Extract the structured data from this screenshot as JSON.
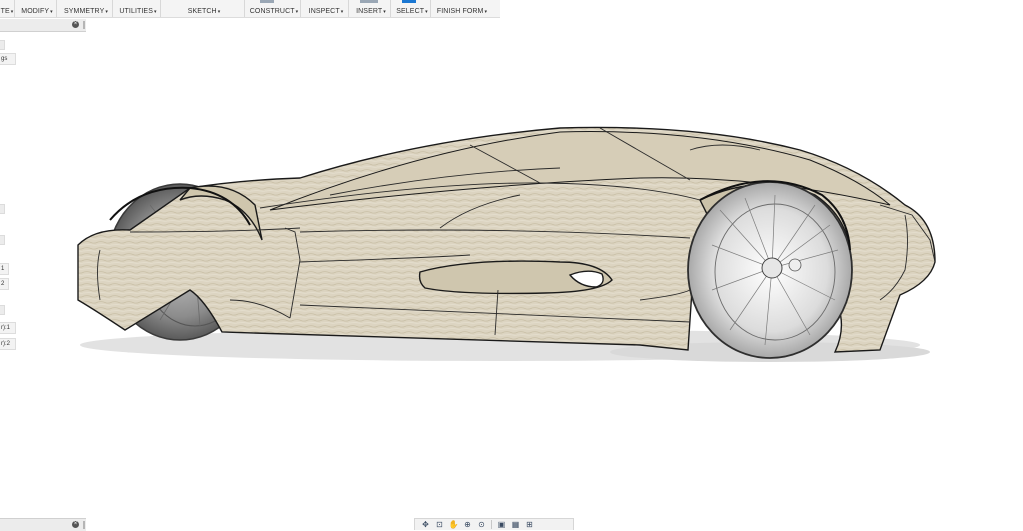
{
  "toolbar": {
    "groups": [
      {
        "label": "TE",
        "icon": "create-icon"
      },
      {
        "label": "MODIFY",
        "icon": "modify-icon"
      },
      {
        "label": "SYMMETRY",
        "icon": "symmetry-icon"
      },
      {
        "label": "UTILITIES",
        "icon": "utilities-icon"
      },
      {
        "label": "SKETCH",
        "icon": "sketch-icon"
      },
      {
        "label": "CONSTRUCT",
        "icon": "construct-icon"
      },
      {
        "label": "INSPECT",
        "icon": "inspect-icon"
      },
      {
        "label": "INSERT",
        "icon": "insert-icon"
      },
      {
        "label": "SELECT",
        "icon": "select-icon"
      },
      {
        "label": "FINISH FORM",
        "icon": "finish-form-icon"
      }
    ],
    "caret": "▾"
  },
  "browser": {
    "close_glyph": "×",
    "items": [
      "gs",
      "1",
      "2",
      "r):1",
      "r):2"
    ]
  },
  "navbar": {
    "buttons": [
      {
        "name": "orbit-icon",
        "glyph": "✥"
      },
      {
        "name": "look-at-icon",
        "glyph": "⊡"
      },
      {
        "name": "pan-icon",
        "glyph": "✋"
      },
      {
        "name": "zoom-icon",
        "glyph": "⊕"
      },
      {
        "name": "fit-icon",
        "glyph": "⊙"
      },
      {
        "name": "display-settings-icon",
        "glyph": "▣"
      },
      {
        "name": "grid-settings-icon",
        "glyph": "▦"
      },
      {
        "name": "viewports-icon",
        "glyph": "⊞"
      }
    ]
  },
  "colors": {
    "body_fill": "#d9d1bd",
    "body_shadow": "#bdb39b",
    "edge": "#1a1a1a",
    "ground_shadow": "#d8d8d8",
    "wheel_tint": "#9a9a9a",
    "accent": "#1b77d2"
  }
}
